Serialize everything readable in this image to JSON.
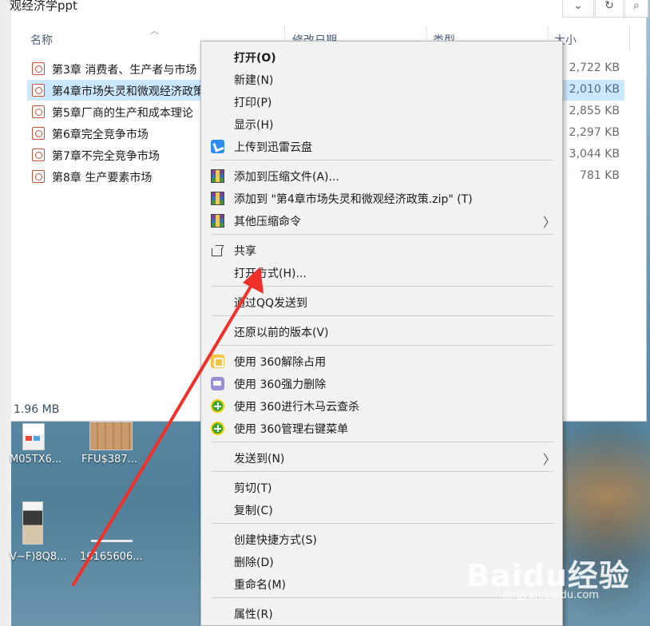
{
  "window": {
    "title": "观经济学ppt",
    "dropdown_glyph": "⌄",
    "refresh_glyph": "↻",
    "search_glyph": "⌕"
  },
  "columns": {
    "name": "名称",
    "date": "修改日期",
    "type": "类型",
    "size": "大小"
  },
  "files": [
    {
      "name": "第3章 消费者、生产者与市场",
      "size": "2,722 KB",
      "selected": false
    },
    {
      "name": "第4章市场失灵和微观经济政策",
      "size": "2,010 KB",
      "selected": true
    },
    {
      "name": "第5章厂商的生产和成本理论",
      "size": "2,855 KB",
      "selected": false
    },
    {
      "name": "第6章完全竞争市场",
      "size": "2,297 KB",
      "selected": false
    },
    {
      "name": "第7章不完全竞争市场",
      "size": "3,044 KB",
      "selected": false
    },
    {
      "name": "第8章 生产要素市场",
      "size": "781 KB",
      "selected": false
    }
  ],
  "status": "1.96 MB",
  "desktop_icons": [
    {
      "label": "M05TX6..."
    },
    {
      "label": "FFU$387..."
    },
    {
      "label": "V~F)8Q8..."
    },
    {
      "label": "16165606..."
    }
  ],
  "menu": {
    "items": [
      {
        "label": "打开(O)",
        "icon": "",
        "bold": true
      },
      {
        "label": "新建(N)",
        "icon": ""
      },
      {
        "label": "打印(P)",
        "icon": ""
      },
      {
        "label": "显示(H)",
        "icon": ""
      },
      {
        "label": "上传到迅雷云盘",
        "icon": "xunlei-icon"
      },
      {
        "label": "添加到压缩文件(A)...",
        "icon": "winrar-icon"
      },
      {
        "label": "添加到 \"第4章市场失灵和微观经济政策.zip\" (T)",
        "icon": "winrar-icon"
      },
      {
        "label": "其他压缩命令",
        "icon": "winrar-icon",
        "submenu": true
      },
      {
        "label": "共享",
        "icon": "share-icon"
      },
      {
        "label": "打开方式(H)...",
        "icon": ""
      },
      {
        "label": "通过QQ发送到",
        "icon": ""
      },
      {
        "label": "还原以前的版本(V)",
        "icon": ""
      },
      {
        "label": "使用 360解除占用",
        "icon": "360-unlock-icon"
      },
      {
        "label": "使用 360强力删除",
        "icon": "360-shred-icon"
      },
      {
        "label": "使用 360进行木马云查杀",
        "icon": "360-scan-icon"
      },
      {
        "label": "使用 360管理右键菜单",
        "icon": "360-menu-icon"
      },
      {
        "label": "发送到(N)",
        "icon": "",
        "submenu": true
      },
      {
        "label": "剪切(T)",
        "icon": ""
      },
      {
        "label": "复制(C)",
        "icon": ""
      },
      {
        "label": "创建快捷方式(S)",
        "icon": ""
      },
      {
        "label": "删除(D)",
        "icon": ""
      },
      {
        "label": "重命名(M)",
        "icon": ""
      },
      {
        "label": "属性(R)",
        "icon": ""
      }
    ],
    "submenu_glyph": "〉"
  },
  "watermark": {
    "text": "Baidu经验",
    "sub": "jingyan.baidu.com"
  },
  "colors": {
    "selection": "#cce8ff",
    "menu_bg": "#f2f2f2",
    "arrow": "#f0302a"
  }
}
